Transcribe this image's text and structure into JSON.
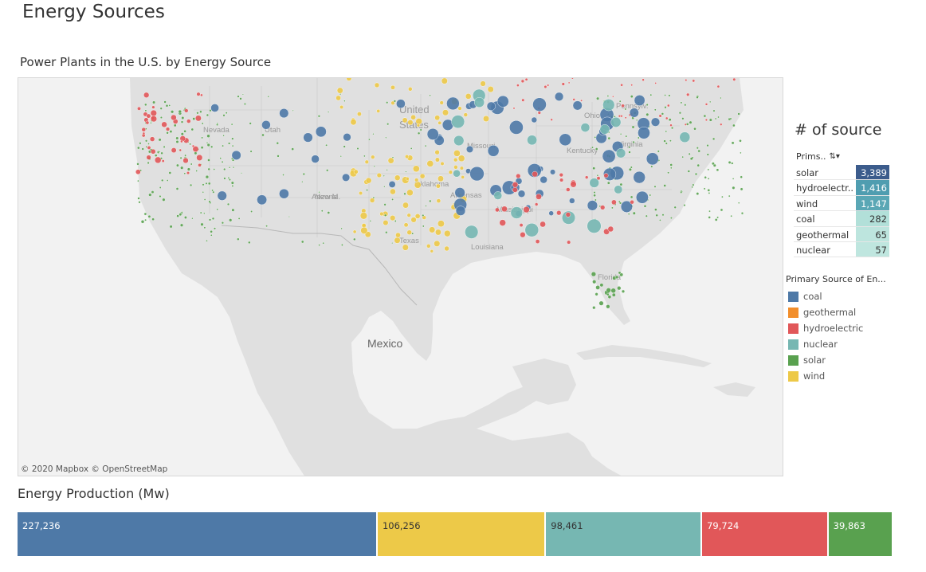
{
  "page": {
    "title": "Energy Sources"
  },
  "map": {
    "title": "Power Plants in the U.S. by Energy Source",
    "attribution": "© 2020 Mapbox © OpenStreetMap",
    "labels": [
      "Nevada",
      "Utah",
      "United",
      "States",
      "Missouri",
      "Arizona",
      "New M.",
      "Oklahoma",
      "Arkansas",
      "Mississippi",
      "Texas",
      "Louisiana",
      "Florida",
      "Ohio",
      "Virginia",
      "Pennsylv.",
      "Kentucky",
      "Mexico"
    ]
  },
  "colors": {
    "coal": "#4e79a7",
    "geothermal": "#f28e2b",
    "hydroelectric": "#e15759",
    "nuclear": "#76b7b2",
    "solar": "#59a14f",
    "wind": "#edc948"
  },
  "count_table": {
    "title": "# of source",
    "header": "Prims..",
    "sort_icon": "sort-descending-icon",
    "rows": [
      {
        "label": "solar",
        "value": "3,389",
        "bg": "#3c5c8c",
        "fg": "#ffffff"
      },
      {
        "label": "hydroelectr..",
        "value": "1,416",
        "bg": "#4f9db0",
        "fg": "#ffffff"
      },
      {
        "label": "wind",
        "value": "1,147",
        "bg": "#5aa7b5",
        "fg": "#ffffff"
      },
      {
        "label": "coal",
        "value": "282",
        "bg": "#b2e0d9",
        "fg": "#333333"
      },
      {
        "label": "geothermal",
        "value": "65",
        "bg": "#bde5de",
        "fg": "#333333"
      },
      {
        "label": "nuclear",
        "value": "57",
        "bg": "#bfe6df",
        "fg": "#333333"
      }
    ]
  },
  "legend": {
    "title": "Primary Source of En...",
    "items": [
      {
        "label": "coal",
        "color": "#4e79a7"
      },
      {
        "label": "geothermal",
        "color": "#f28e2b"
      },
      {
        "label": "hydroelectric",
        "color": "#e15759"
      },
      {
        "label": "nuclear",
        "color": "#76b7b2"
      },
      {
        "label": "solar",
        "color": "#59a14f"
      },
      {
        "label": "wind",
        "color": "#edc948"
      }
    ]
  },
  "production": {
    "title": "Energy Production (Mw)",
    "segments": [
      {
        "label": "227,236",
        "value": 227236,
        "color": "#4e79a7",
        "fg": "#ffffff"
      },
      {
        "label": "106,256",
        "value": 106256,
        "color": "#edc948",
        "fg": "#333333"
      },
      {
        "label": "98,461",
        "value": 98461,
        "color": "#76b7b2",
        "fg": "#333333"
      },
      {
        "label": "79,724",
        "value": 79724,
        "color": "#e15759",
        "fg": "#ffffff"
      },
      {
        "label": "39,863",
        "value": 39863,
        "color": "#59a14f",
        "fg": "#ffffff"
      }
    ]
  }
}
